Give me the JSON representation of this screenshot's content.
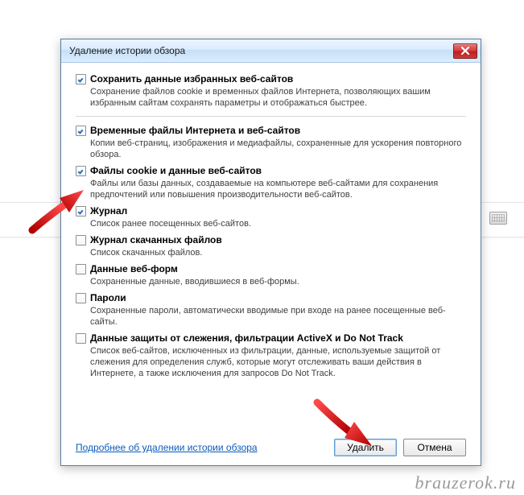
{
  "dialog": {
    "title": "Удаление истории обзора",
    "items": [
      {
        "checked": true,
        "label": "Сохранить данные избранных веб-сайтов",
        "desc": "Сохранение файлов cookie и временных файлов Интернета, позволяющих вашим избранным сайтам сохранять параметры и отображаться быстрее."
      },
      {
        "checked": true,
        "label": "Временные файлы Интернета и веб-сайтов",
        "desc": "Копии веб-страниц, изображения и медиафайлы, сохраненные для ускорения повторного обзора."
      },
      {
        "checked": true,
        "label": "Файлы cookie и данные веб-сайтов",
        "desc": "Файлы или базы данных, создаваемые на компьютере веб-сайтами для сохранения предпочтений или повышения производительности веб-сайтов."
      },
      {
        "checked": true,
        "label": "Журнал",
        "desc": "Список ранее посещенных веб-сайтов."
      },
      {
        "checked": false,
        "label": "Журнал скачанных файлов",
        "desc": "Список скачанных файлов."
      },
      {
        "checked": false,
        "label": "Данные веб-форм",
        "desc": "Сохраненные данные, вводившиеся в веб-формы."
      },
      {
        "checked": false,
        "label": "Пароли",
        "desc": "Сохраненные пароли, автоматически вводимые при входе на ранее посещенные веб-сайты."
      },
      {
        "checked": false,
        "label": "Данные защиты от слежения, фильтрации ActiveX и Do Not Track",
        "desc": "Список веб-сайтов, исключенных из фильтрации, данные, используемые защитой от слежения для определения служб, которые могут отслеживать ваши действия в Интернете, а также исключения для запросов Do Not Track."
      }
    ],
    "more_link": "Подробнее об удалении истории обзора",
    "delete_btn": "Удалить",
    "cancel_btn": "Отмена"
  },
  "watermark": "brauzerok.ru"
}
